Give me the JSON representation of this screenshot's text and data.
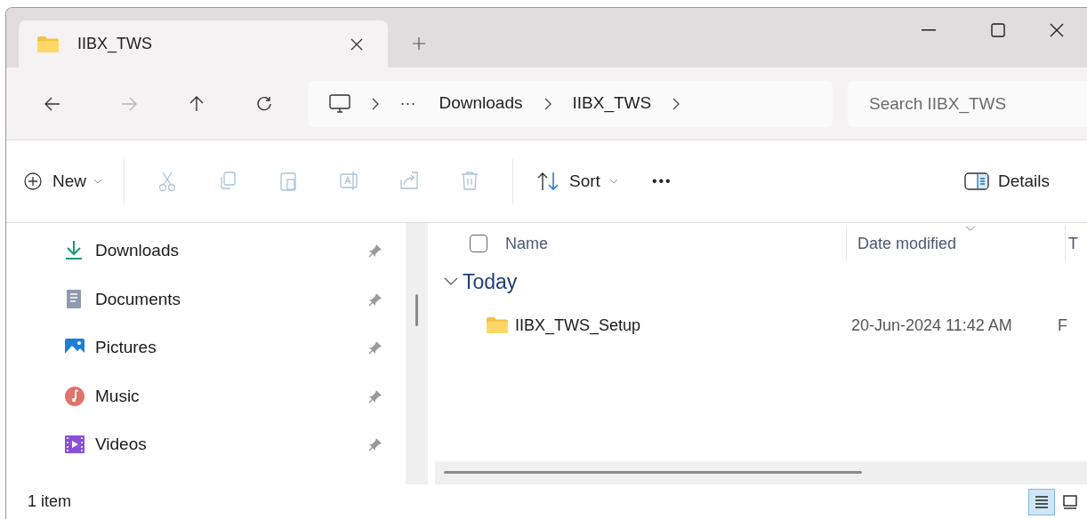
{
  "tabs": [
    {
      "title": "IIBX_TWS",
      "selected": true
    }
  ],
  "nav": [
    {
      "kind": "back",
      "disabled": false
    },
    {
      "kind": "forward",
      "disabled": true
    },
    {
      "kind": "up",
      "disabled": false
    },
    {
      "kind": "refresh",
      "disabled": false
    }
  ],
  "address_bar": {
    "overflow": "···",
    "segments": [
      "Downloads",
      "IIBX_TWS"
    ]
  },
  "search": {
    "placeholder": "Search IIBX_TWS"
  },
  "toolbar": {
    "new_label": "New",
    "actions": [
      {
        "kind": "cut",
        "disabled": true
      },
      {
        "kind": "copy",
        "disabled": true
      },
      {
        "kind": "paste",
        "disabled": true
      },
      {
        "kind": "rename",
        "disabled": true
      },
      {
        "kind": "share",
        "disabled": true
      },
      {
        "kind": "delete",
        "disabled": true
      }
    ],
    "sort_label": "Sort",
    "more": "•••",
    "details_label": "Details"
  },
  "sidebar": {
    "items": [
      {
        "label": "Downloads",
        "kind": "downloads",
        "pinned": true
      },
      {
        "label": "Documents",
        "kind": "documents",
        "pinned": true
      },
      {
        "label": "Pictures",
        "kind": "pictures",
        "pinned": true
      },
      {
        "label": "Music",
        "kind": "music",
        "pinned": true
      },
      {
        "label": "Videos",
        "kind": "videos",
        "pinned": true
      }
    ]
  },
  "content": {
    "select_all_checked": false,
    "columns": [
      "Name",
      "Date modified",
      "T"
    ],
    "groups": [
      {
        "label": "Today",
        "expanded": true,
        "rows": [
          {
            "name": "IIBX_TWS_Setup",
            "date_modified": "20-Jun-2024 11:42 AM",
            "column_3": "F"
          }
        ]
      }
    ]
  },
  "status_bar": {
    "text": "1 item",
    "views": [
      {
        "kind": "details",
        "selected": true
      },
      {
        "kind": "tiles",
        "selected": false
      }
    ]
  }
}
